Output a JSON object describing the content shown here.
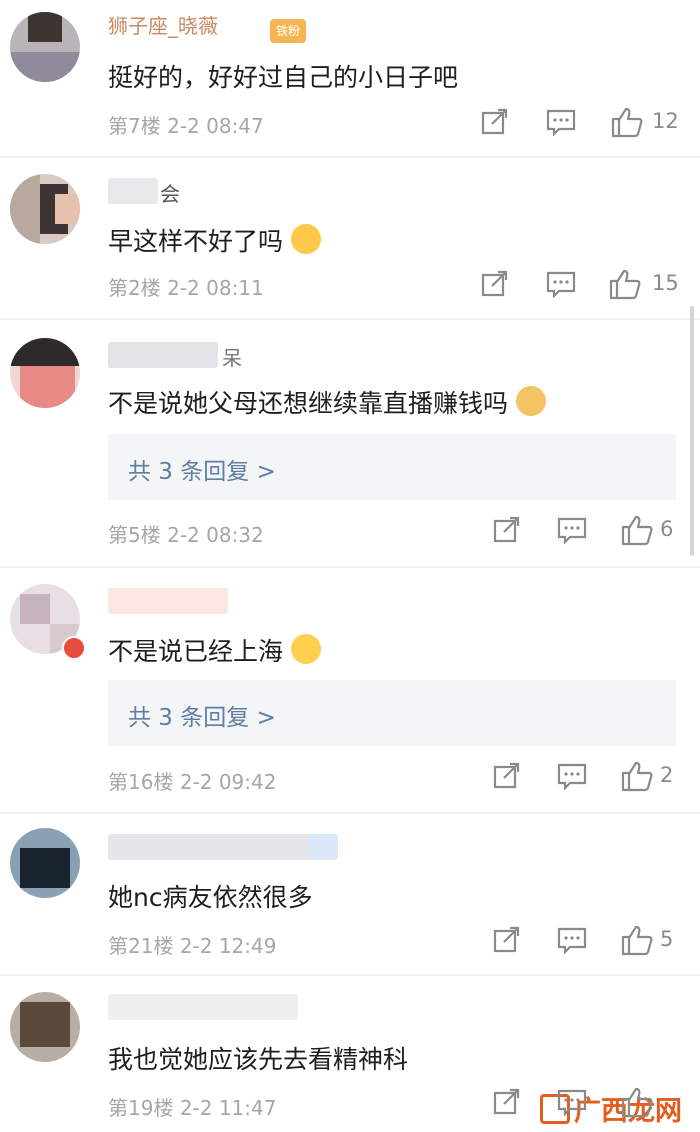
{
  "comments": [
    {
      "user": "狮子座_晓薇",
      "badge": "铁粉",
      "text": "挺好的，好好过自己的小日子吧",
      "floor": "第7楼",
      "time": "2-2 08:47",
      "likes": "12",
      "replies": ""
    },
    {
      "user": "会",
      "badge": "",
      "text": "早这样不好了吗",
      "floor": "第2楼",
      "time": "2-2 08:11",
      "likes": "15",
      "replies": ""
    },
    {
      "user": "呆",
      "badge": "",
      "text": "不是说她父母还想继续靠直播赚钱吗",
      "floor": "第5楼",
      "time": "2-2 08:32",
      "likes": "6",
      "replies": "共 3 条回复 >"
    },
    {
      "user": "",
      "badge": "",
      "text": "不是说已经上海",
      "floor": "第16楼",
      "time": "2-2 09:42",
      "likes": "2",
      "replies": "共 3 条回复 >"
    },
    {
      "user": "",
      "badge": "",
      "text": "她nc病友依然很多",
      "floor": "第21楼",
      "time": "2-2 12:49",
      "likes": "5",
      "replies": ""
    },
    {
      "user": "",
      "badge": "",
      "text": "我也觉她应该先去看精神科",
      "floor": "第19楼",
      "time": "2-2 11:47",
      "likes": "",
      "replies": ""
    }
  ],
  "icons": {
    "share": "share-icon",
    "comment": "comment-icon",
    "like": "thumbs-up-icon"
  },
  "watermark": "广西龙网",
  "colors": {
    "reply_link": "#5e7ea3",
    "meta": "#a6a6a6",
    "badge": "#f7b552"
  }
}
